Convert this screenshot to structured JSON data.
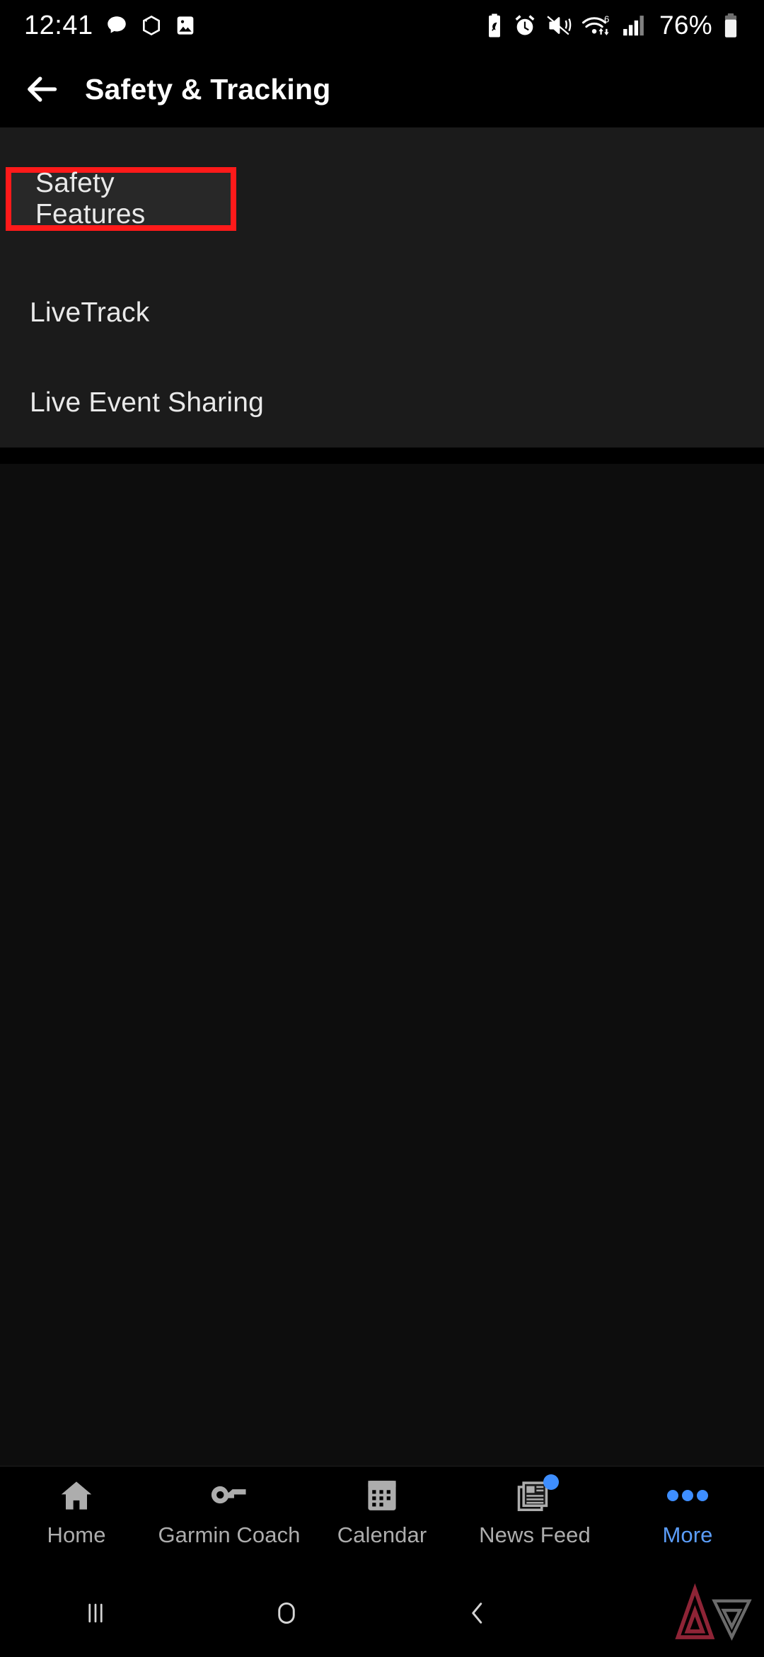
{
  "statusbar": {
    "time": "12:41",
    "battery_percent": "76%",
    "left_icons": [
      "chat-bubble-icon",
      "hexagon-loop-icon",
      "gallery-image-icon"
    ],
    "right_icons": [
      "battery-saver-icon",
      "alarm-clock-icon",
      "mute-vibrate-icon",
      "wifi-6-icon",
      "cellular-signal-icon",
      "battery-icon"
    ]
  },
  "header": {
    "title": "Safety & Tracking",
    "back_icon": "arrow-left-icon"
  },
  "list": {
    "items": [
      {
        "label": "Safety Features",
        "highlighted": true
      },
      {
        "label": "LiveTrack",
        "highlighted": false
      },
      {
        "label": "Live Event Sharing",
        "highlighted": false
      }
    ]
  },
  "bottom_nav": {
    "items": [
      {
        "label": "Home",
        "icon": "home-icon",
        "active": false,
        "badge": false
      },
      {
        "label": "Garmin Coach",
        "icon": "whistle-icon",
        "active": false,
        "badge": false
      },
      {
        "label": "Calendar",
        "icon": "calendar-icon",
        "active": false,
        "badge": false
      },
      {
        "label": "News Feed",
        "icon": "news-feed-icon",
        "active": false,
        "badge": true
      },
      {
        "label": "More",
        "icon": "more-dots-icon",
        "active": true,
        "badge": false
      }
    ]
  },
  "system_nav": {
    "recents_icon": "recents-icon",
    "home_icon": "home-circle-icon",
    "back_icon": "back-chevron-icon",
    "watermark_icon": "triangle-watermark-icon"
  },
  "colors": {
    "accent_blue": "#5b9df9",
    "highlight_red": "#ff1a1a",
    "list_bg": "#1b1b1b",
    "page_bg": "#0d0d0d",
    "bar_bg": "#000000"
  }
}
